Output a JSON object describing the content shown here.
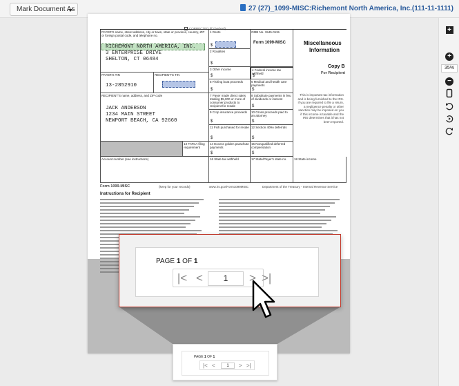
{
  "toolbar": {
    "mark_document_label": "Mark Document As",
    "document_title": "27 (27)_1099-MISC:Richemont North America, Inc.(111-11-1111)"
  },
  "sidebar": {
    "zoom_level": "35%"
  },
  "form": {
    "corrected_label": "CORRECTED (if checked)",
    "payer_label": "PAYER'S name, street address, city or town, state or province, country, ZIP or foreign postal code, and telephone no.",
    "payer_name": "RICHEMONT NORTH AMERICA, INC.",
    "payer_street": "3 ENTERPRISE DRIVE",
    "payer_city": "SHELTON, CT 06484",
    "rents_label": "1 Rents",
    "royalties_label": "2 Royalties",
    "other_income_label": "3 Other income",
    "fed_tax_label": "4 Federal income tax withheld",
    "omb": "OMB No. 1545-0115",
    "form_name": "Form 1099-MISC",
    "title1": "Miscellaneous",
    "title2": "Information",
    "copy_b": "Copy B",
    "for_recipient": "For Recipient",
    "payer_tin_label": "PAYER'S TIN",
    "payer_tin": "13-2852910",
    "recipient_tin_label": "RECIPIENT'S TIN",
    "fishing_label": "5 Fishing boat proceeds",
    "medical_label": "6 Medical and health care payments",
    "recipient_name_label": "RECIPIENT'S name, address, and ZIP code",
    "recipient_name": "JACK ANDERSON",
    "recipient_street": "1234 MAIN STREET",
    "recipient_city": "NEWPORT BEACH, CA 92660",
    "direct_sales_label": "7 Payer made direct sales totaling $5,000 or more of consumer products to recipient for resale",
    "substitute_label": "8 Substitute payments in lieu of dividends or interest",
    "crop_label": "9 Crop insurance proceeds",
    "gross_label": "10 Gross proceeds paid to an attorney",
    "fish_purchased_label": "11 Fish purchased for resale",
    "sec409a_label": "12 Section 409A deferrals",
    "fatca_label": "13 FATCA filing requirement",
    "golden_label": "14 Excess golden parachute payments",
    "nonqual_label": "15 Nonqualified deferred compensation",
    "account_label": "Account number (see instructions)",
    "state_tax_label": "16 State tax withheld",
    "state_no_label": "17 State/Payer's state no.",
    "state_income_label": "18 State income",
    "footer_form": "Form 1099-MISC",
    "footer_keep": "(keep for your records)",
    "footer_url": "www.irs.gov/Form1099MISC",
    "footer_dept": "Department of the Treasury - Internal Revenue Service",
    "side_note": "This is important tax information and is being furnished to the IRS. If you are required to file a return, a negligence penalty or other sanction may be imposed on you if this income is taxable and the IRS determines that it has not been reported.",
    "dollar": "$",
    "instructions_title": "Instructions for Recipient"
  },
  "pagination": {
    "page_prefix": "PAGE ",
    "current_page": "1",
    "of_label": " OF ",
    "total_pages": "1",
    "input_value": "1"
  },
  "icons": {
    "first": "first-page-icon",
    "prev": "prev-page-icon",
    "next": "next-page-icon",
    "last": "last-page-icon"
  }
}
